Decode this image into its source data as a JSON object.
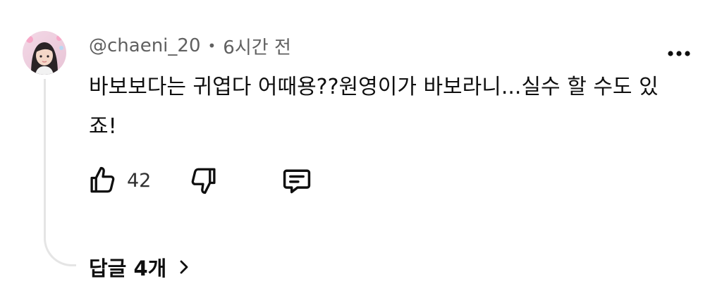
{
  "comment": {
    "author": "@chaeni_20",
    "separator": "•",
    "time": "6시간 전",
    "text": "바보보다는 귀엽다 어때용??원영이가 바보라니...실수 할 수도 있죠!",
    "avatar_icon": "user-avatar-photo",
    "more_icon": "more-vertical-dots-icon"
  },
  "actions": {
    "like_icon": "thumbs-up-icon",
    "like_count": "42",
    "dislike_icon": "thumbs-down-icon",
    "reply_icon": "comment-reply-icon"
  },
  "replies": {
    "label": "답글 4개",
    "chevron_icon": "chevron-right-icon"
  },
  "colors": {
    "text_primary": "#0f0f0f",
    "text_secondary": "#606060",
    "thread_line": "#e5e5e5",
    "background": "#ffffff"
  }
}
